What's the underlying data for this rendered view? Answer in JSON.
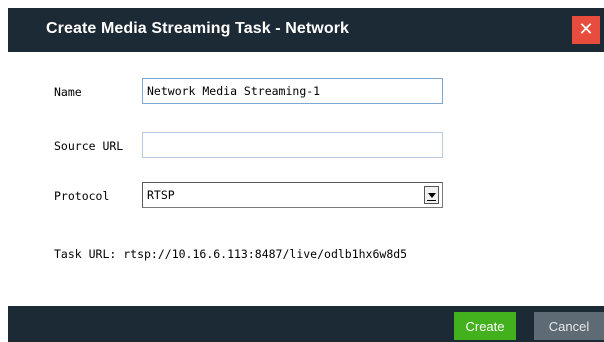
{
  "dialog": {
    "title": "Create Media Streaming Task - Network",
    "close_glyph": "✕"
  },
  "form": {
    "name_label": "Name",
    "name_value": "Network Media Streaming-1",
    "source_url_label": "Source URL",
    "source_url_value": "",
    "protocol_label": "Protocol",
    "protocol_selected": "RTSP",
    "task_url_text": "Task URL: rtsp://10.16.6.113:8487/live/odlb1hx6w8d5"
  },
  "footer": {
    "create_label": "Create",
    "cancel_label": "Cancel"
  },
  "colors": {
    "titlebar": "#1c2a36",
    "close": "#e74c3c",
    "create": "#43b01e",
    "cancel": "#5e6a74"
  },
  "icons": {
    "close": "close-icon",
    "dropdown": "chevron-down-icon"
  }
}
